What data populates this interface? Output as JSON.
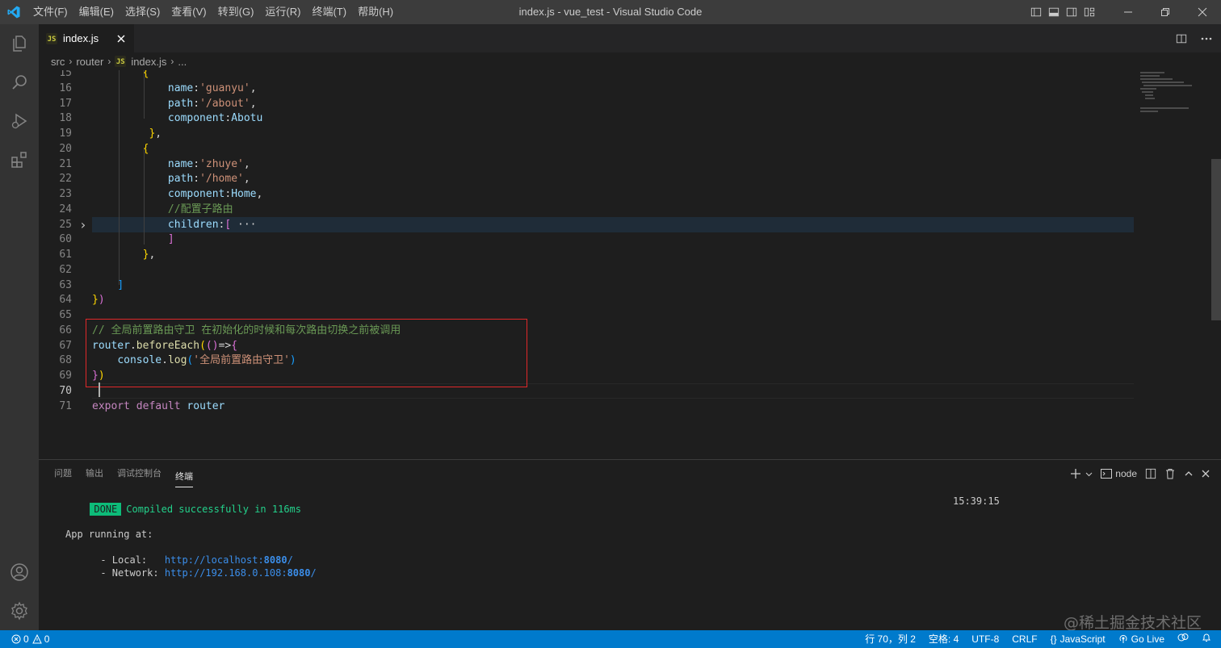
{
  "app": {
    "window_title": "index.js - vue_test - Visual Studio Code",
    "menu": [
      "文件(F)",
      "编辑(E)",
      "选择(S)",
      "查看(V)",
      "转到(G)",
      "运行(R)",
      "终端(T)",
      "帮助(H)"
    ]
  },
  "activity_bar": {
    "items": [
      "explorer-icon",
      "search-icon",
      "run-debug-icon",
      "extensions-icon"
    ],
    "bottom": [
      "account-icon",
      "gear-icon"
    ]
  },
  "tabs": [
    {
      "label": "index.js",
      "icon": "JS",
      "active": true
    }
  ],
  "breadcrumb": [
    "src",
    "router",
    "index.js",
    "..."
  ],
  "editor": {
    "lines": [
      {
        "n": "15",
        "html": "        <span class='b1'>{</span>"
      },
      {
        "n": "16",
        "html": "            <span class='p'>name</span>:<span class='s'>'guanyu'</span>,"
      },
      {
        "n": "17",
        "html": "            <span class='p'>path</span>:<span class='s'>'/about'</span>,"
      },
      {
        "n": "18",
        "html": "            <span class='p'>component</span>:<span class='vv'>Abotu</span>"
      },
      {
        "n": "19",
        "html": "         <span class='b1'>}</span>,"
      },
      {
        "n": "20",
        "html": "        <span class='b1'>{</span>"
      },
      {
        "n": "21",
        "html": "            <span class='p'>name</span>:<span class='s'>'zhuye'</span>,"
      },
      {
        "n": "22",
        "html": "            <span class='p'>path</span>:<span class='s'>'/home'</span>,"
      },
      {
        "n": "23",
        "html": "            <span class='p'>component</span>:<span class='vv'>Home</span>,"
      },
      {
        "n": "24",
        "html": "            <span class='c'>//配置子路由</span>"
      },
      {
        "n": "25",
        "html": "            <span class='p'>children</span>:<span class='b2'>[</span><span class='t'> ···</span>",
        "fold": true
      },
      {
        "n": "60",
        "html": "            <span class='b2'>]</span>"
      },
      {
        "n": "61",
        "html": "        <span class='b1'>}</span>,"
      },
      {
        "n": "62",
        "html": ""
      },
      {
        "n": "63",
        "html": "    <span class='b3'>]</span>"
      },
      {
        "n": "64",
        "html": "<span class='b1'>}</span><span class='b2'>)</span>"
      },
      {
        "n": "65",
        "html": ""
      },
      {
        "n": "66",
        "html": "<span class='c'>// 全局前置路由守卫 在初始化的时候和每次路由切换之前被调用</span>"
      },
      {
        "n": "67",
        "html": "<span class='vv'>router</span>.<span class='f'>beforeEach</span><span class='b1'>(</span><span class='b2'>()</span>=><span class='b2'>{</span>"
      },
      {
        "n": "68",
        "html": "    <span class='vv'>console</span>.<span class='f'>log</span><span class='b3'>(</span><span class='s'>'全局前置路由守卫'</span><span class='b3'>)</span>"
      },
      {
        "n": "69",
        "html": "<span class='b2'>}</span><span class='b1'>)</span>"
      },
      {
        "n": "70",
        "html": ""
      },
      {
        "n": "71",
        "html": "<span class='k'>export</span> <span class='k'>default</span> <span class='vv'>router</span>"
      }
    ]
  },
  "panel": {
    "tabs": [
      "问题",
      "输出",
      "调试控制台",
      "终端"
    ],
    "active_tab": "终端",
    "terminal_name": "node",
    "terminal": {
      "done": "DONE",
      "compiled": "Compiled successfully in 116ms",
      "time": "15:39:15",
      "app_running": "App running at:",
      "local_label": "- Local:   ",
      "local_url_pre": "http://localhost:",
      "local_port": "8080",
      "local_url_post": "/",
      "network_label": "- Network: ",
      "network_url_pre": "http://192.168.0.108:",
      "network_port": "8080",
      "network_url_post": "/"
    }
  },
  "statusbar": {
    "errors": "0",
    "warnings": "0",
    "position": "行 70，列 2",
    "spaces": "空格: 4",
    "encoding": "UTF-8",
    "eol": "CRLF",
    "language": "JavaScript",
    "golive": "Go Live"
  },
  "watermark": "@稀土掘金技术社区",
  "colors": {
    "titlebar": "#3c3c3c",
    "activitybar": "#333333",
    "editor_bg": "#1e1e1e",
    "statusbar": "#007acc",
    "highlight_box": "#e0282a"
  }
}
